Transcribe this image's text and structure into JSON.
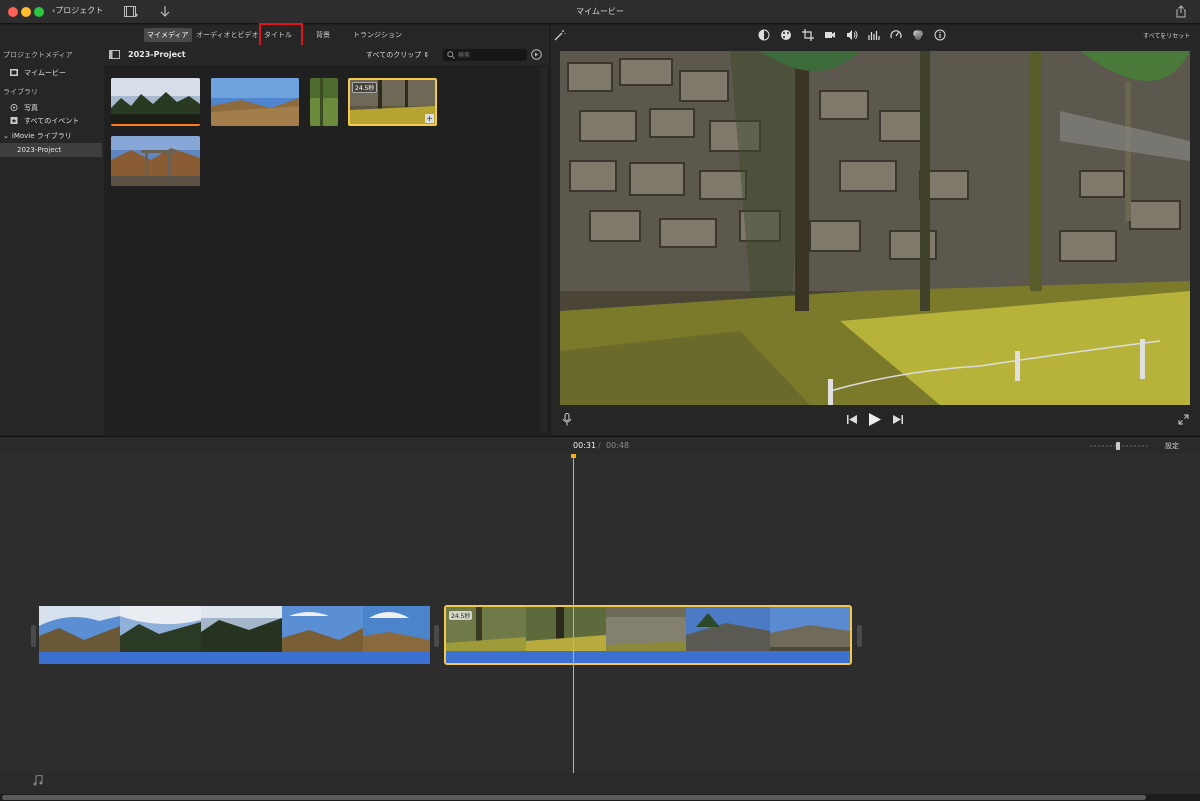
{
  "window": {
    "title": "マイムービー",
    "back_label": "プロジェクト"
  },
  "tabs": [
    {
      "label": "マイメディア"
    },
    {
      "label": "オーディオとビデオ"
    },
    {
      "label": "タイトル"
    },
    {
      "label": "背景"
    },
    {
      "label": "トランジション"
    }
  ],
  "sidebar": {
    "project_media_heading": "プロジェクトメディア",
    "project_item": "マイムービー",
    "library_heading": "ライブラリ",
    "photos_item": "写真",
    "all_events_item": "すべてのイベント",
    "imovie_library_item": "iMovie ライブラリ",
    "selected_project_item": "2023-Project"
  },
  "browser": {
    "project_title": "2023-Project",
    "clip_filter": "すべてのクリップ",
    "search_placeholder": "検索",
    "selected_clip_duration": "24.5秒"
  },
  "viewer": {
    "reset_all_label": "すべてをリセット"
  },
  "timeline": {
    "current_time": "00:31",
    "separator": "/",
    "total_time": "00:48",
    "settings_label": "設定",
    "clip2_duration": "24.5秒"
  },
  "colors": {
    "accent_yellow": "#f2c94c",
    "audio_blue": "#3b6fd0",
    "annotation_red": "#e0161e",
    "used_orange": "#ff7a1a"
  }
}
